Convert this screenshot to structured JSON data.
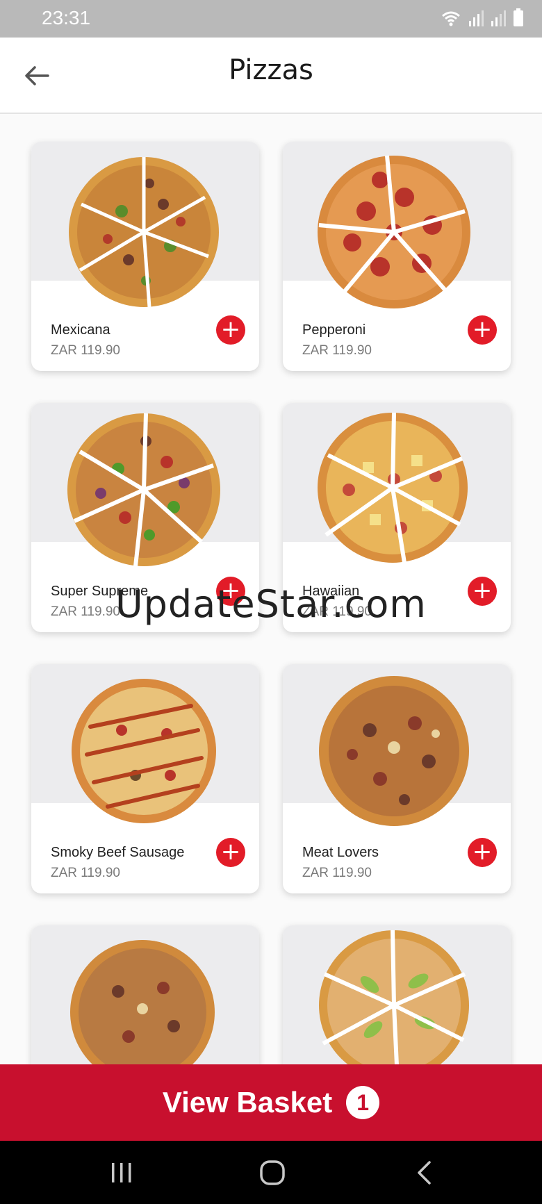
{
  "status_bar": {
    "time": "23:31"
  },
  "header": {
    "title": "Pizzas"
  },
  "products": [
    {
      "name": "Mexicana",
      "price": "ZAR 119.90"
    },
    {
      "name": "Pepperoni",
      "price": "ZAR 119.90"
    },
    {
      "name": "Super Supreme",
      "price": "ZAR 119.90"
    },
    {
      "name": "Hawaiian",
      "price": "ZAR 119.90"
    },
    {
      "name": "Smoky Beef Sausage",
      "price": "ZAR 119.90"
    },
    {
      "name": "Meat Lovers",
      "price": "ZAR 119.90"
    }
  ],
  "watermark": "UpdateStar.com",
  "basket": {
    "label": "View Basket",
    "count": "1"
  },
  "colors": {
    "accent": "#c8102e",
    "add_button": "#e21c28",
    "crust": "#d99a43",
    "cheese": "#e8b46a"
  }
}
